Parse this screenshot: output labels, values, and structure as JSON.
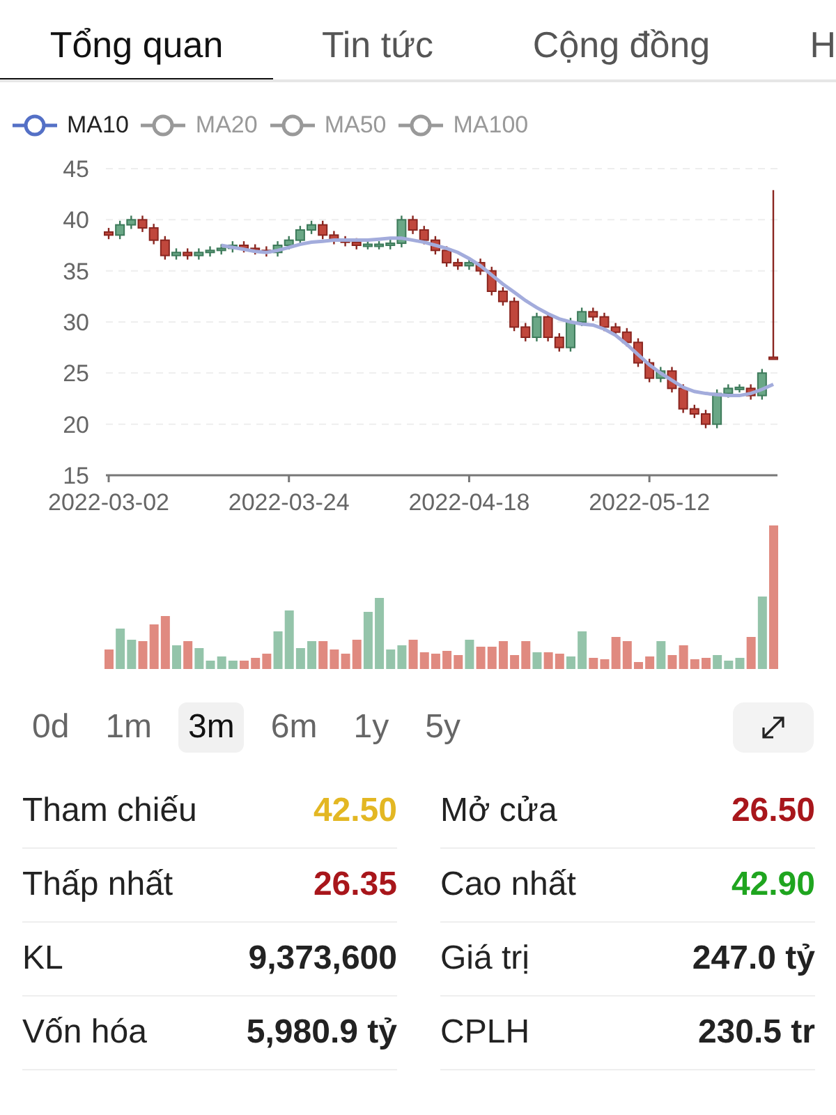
{
  "tabs": [
    {
      "label": "Tổng quan",
      "selected": true
    },
    {
      "label": "Tin tức",
      "selected": false
    },
    {
      "label": "Cộng đồng",
      "selected": false
    },
    {
      "label": "H",
      "selected": false
    }
  ],
  "ma_legend": [
    {
      "kind": "series",
      "selected": true
    },
    {
      "label": "MA20",
      "selected": false
    },
    {
      "label": "MA50",
      "selected": false
    },
    {
      "label": "MA100",
      "selected": false
    }
  ],
  "price_chart": {
    "chart_data": {
      "type": "candlestick",
      "categories": [
        "2022-03-02",
        null,
        null,
        null,
        null,
        null,
        null,
        null,
        null,
        null,
        null,
        null,
        null,
        null,
        null,
        null,
        "2022-03-24",
        null,
        null,
        null,
        null,
        null,
        null,
        null,
        null,
        null,
        null,
        null,
        null,
        null,
        null,
        null,
        "2022-04-18",
        null,
        null,
        null,
        null,
        null,
        null,
        null,
        null,
        null,
        null,
        null,
        null,
        null,
        null,
        null,
        "2022-05-12",
        null,
        null,
        null,
        null,
        null,
        null,
        null,
        null,
        null,
        null,
        null
      ],
      "ylim": [
        15,
        45
      ],
      "yticks": [
        15,
        20,
        25,
        30,
        35,
        40,
        45
      ],
      "grid": true,
      "ohlc": [
        [
          38.8,
          39.2,
          38.1,
          38.5
        ],
        [
          38.5,
          39.9,
          38.1,
          39.5
        ],
        [
          39.5,
          40.4,
          39.1,
          40
        ],
        [
          40,
          40.4,
          38.8,
          39.2
        ],
        [
          39.2,
          39.6,
          37.6,
          38
        ],
        [
          38,
          38.4,
          36.1,
          36.5
        ],
        [
          36.5,
          37.2,
          36.1,
          36.8
        ],
        [
          36.8,
          37.2,
          36.1,
          36.5
        ],
        [
          36.5,
          37.2,
          36.1,
          36.8
        ],
        [
          36.8,
          37.4,
          36.4,
          37
        ],
        [
          37,
          37.6,
          36.6,
          37.2
        ],
        [
          37.2,
          37.9,
          36.8,
          37.5
        ],
        [
          37.5,
          37.9,
          36.8,
          37.2
        ],
        [
          37.2,
          37.6,
          36.6,
          37
        ],
        [
          37,
          37.4,
          36.4,
          36.8
        ],
        [
          36.8,
          37.9,
          36.4,
          37.5
        ],
        [
          37.5,
          38.4,
          37.1,
          38
        ],
        [
          38,
          39.4,
          37.6,
          39
        ],
        [
          39,
          39.9,
          38.6,
          39.5
        ],
        [
          39.5,
          39.9,
          38.1,
          38.5
        ],
        [
          38.5,
          38.9,
          37.6,
          38
        ],
        [
          38,
          38.4,
          37.4,
          37.8
        ],
        [
          37.8,
          38.2,
          37.1,
          37.5
        ],
        [
          37.5,
          37.9,
          37.1,
          37.5
        ],
        [
          37.5,
          37.9,
          37.1,
          37.5
        ],
        [
          37.5,
          38.1,
          37.1,
          37.7
        ],
        [
          37.7,
          40.4,
          37.3,
          40
        ],
        [
          40,
          40.4,
          38.6,
          39
        ],
        [
          39,
          39.4,
          37.6,
          38
        ],
        [
          38,
          38.4,
          36.6,
          37
        ],
        [
          37,
          37.4,
          35.4,
          35.8
        ],
        [
          35.8,
          36.2,
          35.1,
          35.5
        ],
        [
          35.5,
          36.2,
          35.1,
          35.8
        ],
        [
          35.8,
          36.2,
          34.6,
          35
        ],
        [
          35,
          35.4,
          32.6,
          33
        ],
        [
          33,
          33.4,
          31.6,
          32
        ],
        [
          32,
          32.4,
          29.1,
          29.5
        ],
        [
          29.5,
          29.9,
          28.1,
          28.5
        ],
        [
          28.5,
          30.9,
          28.1,
          30.5
        ],
        [
          30.5,
          30.9,
          28.1,
          28.5
        ],
        [
          28.5,
          28.9,
          27.1,
          27.5
        ],
        [
          27.5,
          30.4,
          27.1,
          30
        ],
        [
          30,
          31.4,
          29.6,
          31
        ],
        [
          31,
          31.4,
          30.1,
          30.5
        ],
        [
          30.5,
          30.9,
          29.1,
          29.5
        ],
        [
          29.5,
          29.9,
          28.6,
          29
        ],
        [
          29,
          29.4,
          27.6,
          28
        ],
        [
          28,
          28.4,
          25.6,
          26
        ],
        [
          26,
          26.4,
          24.1,
          24.5
        ],
        [
          24.5,
          25.6,
          24.1,
          25.2
        ],
        [
          25.2,
          25.6,
          23.1,
          23.5
        ],
        [
          23.5,
          23.9,
          21.1,
          21.5
        ],
        [
          21.5,
          21.9,
          20.6,
          21
        ],
        [
          21,
          21.4,
          19.6,
          20
        ],
        [
          20,
          23.4,
          19.6,
          23
        ],
        [
          23,
          23.9,
          22.6,
          23.5
        ],
        [
          23.5,
          23.9,
          23.1,
          23.5
        ],
        [
          23.5,
          23.9,
          22.4,
          22.8
        ],
        [
          22.8,
          25.4,
          22.4,
          25
        ],
        [
          26.5,
          42.9,
          26.4,
          26.4
        ]
      ],
      "series": [
        {
          "name": "MA10",
          "type": "line",
          "color": "#a3acdc",
          "values": [
            null,
            null,
            null,
            null,
            null,
            null,
            null,
            null,
            null,
            null,
            37.5,
            37.3,
            37.1,
            36.9,
            36.8,
            37,
            37.3,
            37.6,
            37.8,
            37.9,
            38,
            38,
            38,
            38,
            38.1,
            38.2,
            38.2,
            38,
            37.8,
            37.5,
            37.2,
            36.8,
            36.2,
            35.5,
            34.6,
            33.7,
            32.9,
            32.1,
            31.4,
            30.8,
            30.3,
            30,
            29.8,
            29.7,
            29.3,
            28.7,
            27.8,
            26.8,
            25.8,
            25,
            24.3,
            23.6,
            23.2,
            23,
            22.9,
            22.8,
            22.8,
            23,
            23.4,
            23.9
          ]
        }
      ]
    }
  },
  "ranges": [
    {
      "label": "0d",
      "selected": false
    },
    {
      "label": "1m",
      "selected": false
    },
    {
      "label": "3m",
      "selected": true
    },
    {
      "label": "6m",
      "selected": false
    },
    {
      "label": "1y",
      "selected": false
    },
    {
      "label": "5y",
      "selected": false
    }
  ],
  "stats": [
    [
      {
        "label": "Tham chiếu",
        "value": "42.50",
        "color": "#e3b723"
      },
      {
        "label": "Mở cửa",
        "value": "26.50",
        "color": "#a8161b"
      }
    ],
    [
      {
        "label": "Thấp nhất",
        "value": "26.35",
        "color": "#a8161b"
      },
      {
        "label": "Cao nhất",
        "value": "42.90",
        "color": "#1fa51f"
      }
    ],
    [
      {
        "label": "KL",
        "value": "9,373,600",
        "color": "#222222"
      },
      {
        "label": "Giá trị",
        "value": "247.0 tỷ",
        "color": "#222222"
      }
    ],
    [
      {
        "label": "Vốn hóa",
        "value": "5,980.9 tỷ",
        "color": "#222222"
      },
      {
        "label": "CPLH",
        "value": "230.5 tr",
        "color": "#222222"
      }
    ]
  ]
}
